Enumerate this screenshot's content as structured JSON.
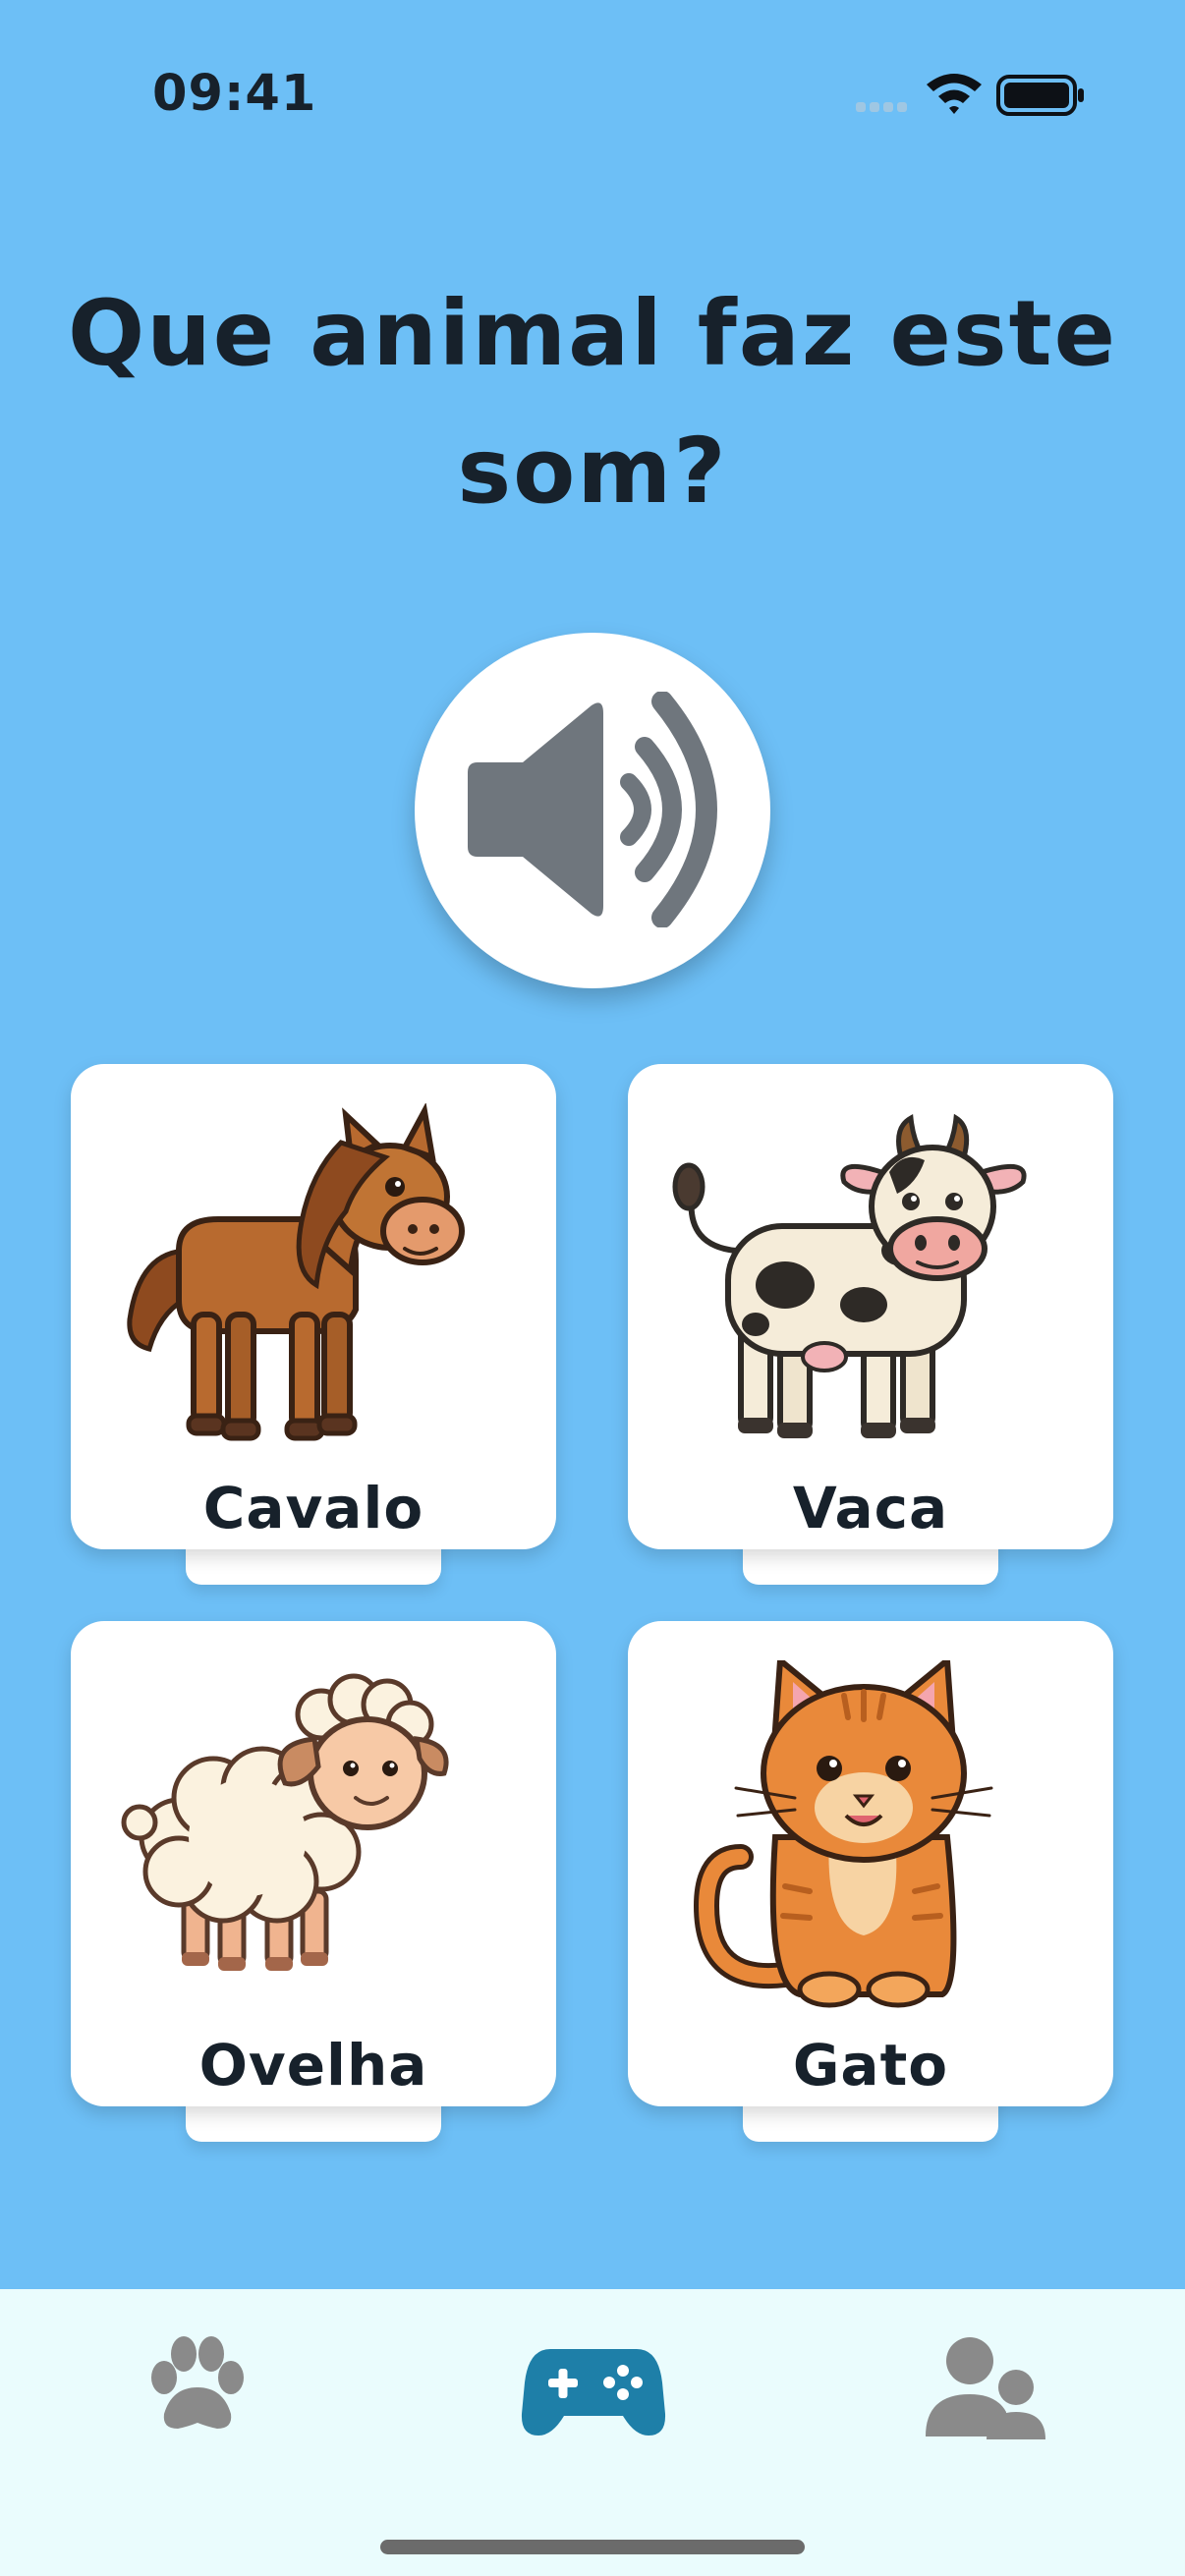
{
  "status_bar": {
    "time": "09:41"
  },
  "question": {
    "text": "Que animal faz este som?"
  },
  "sound_button": {
    "icon": "speaker-icon"
  },
  "options": [
    {
      "label": "Cavalo",
      "icon": "horse-icon"
    },
    {
      "label": "Vaca",
      "icon": "cow-icon"
    },
    {
      "label": "Ovelha",
      "icon": "sheep-icon"
    },
    {
      "label": "Gato",
      "icon": "cat-icon"
    }
  ],
  "tab_bar": {
    "items": [
      {
        "icon": "paw-icon",
        "active": false
      },
      {
        "icon": "gamepad-icon",
        "active": true
      },
      {
        "icon": "users-icon",
        "active": false
      }
    ],
    "active_color": "#1e7fa8",
    "inactive_color": "#8a8a8a"
  },
  "colors": {
    "background": "#6dbff6",
    "card": "#ffffff",
    "text": "#17212b"
  }
}
